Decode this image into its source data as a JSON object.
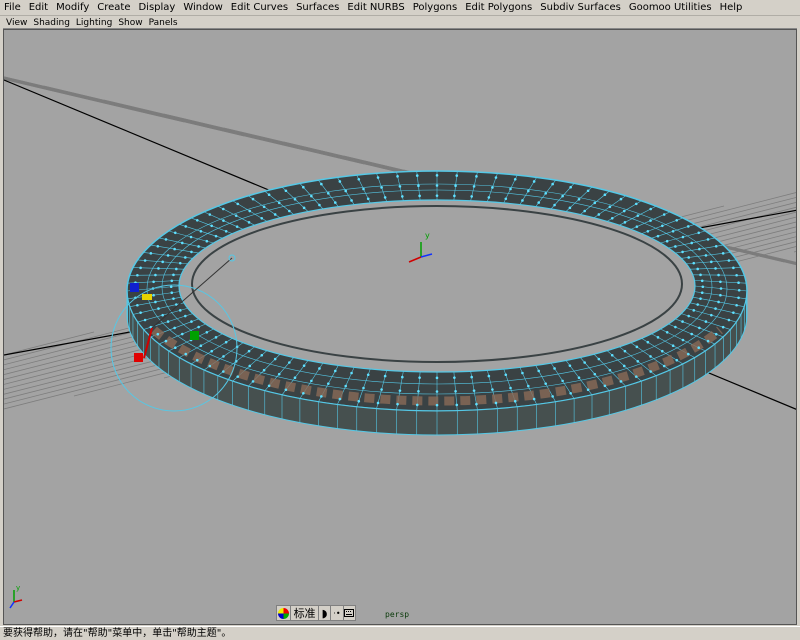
{
  "menu": [
    "File",
    "Edit",
    "Modify",
    "Create",
    "Display",
    "Window",
    "Edit Curves",
    "Surfaces",
    "Edit NURBS",
    "Polygons",
    "Edit Polygons",
    "Subdiv Surfaces",
    "Goomoo Utilities",
    "Help"
  ],
  "panel_menu": [
    "View",
    "Shading",
    "Lighting",
    "Show",
    "Panels"
  ],
  "viewport": {
    "camera": "persp",
    "background": "#a3a3a3",
    "grid_color": "#7d7d7d",
    "wire_color": "#55c8e6",
    "axis_labels": {
      "x": "x",
      "y": "y",
      "z": "z"
    }
  },
  "ime": {
    "icon": "pinwheel-icon",
    "mode": "标准",
    "moon": "moon-icon",
    "dots": "·•",
    "keyboard": "keyboard-icon"
  },
  "status": "要获得帮助，请在\"帮助\"菜单中，单击\"帮助主题\"。"
}
